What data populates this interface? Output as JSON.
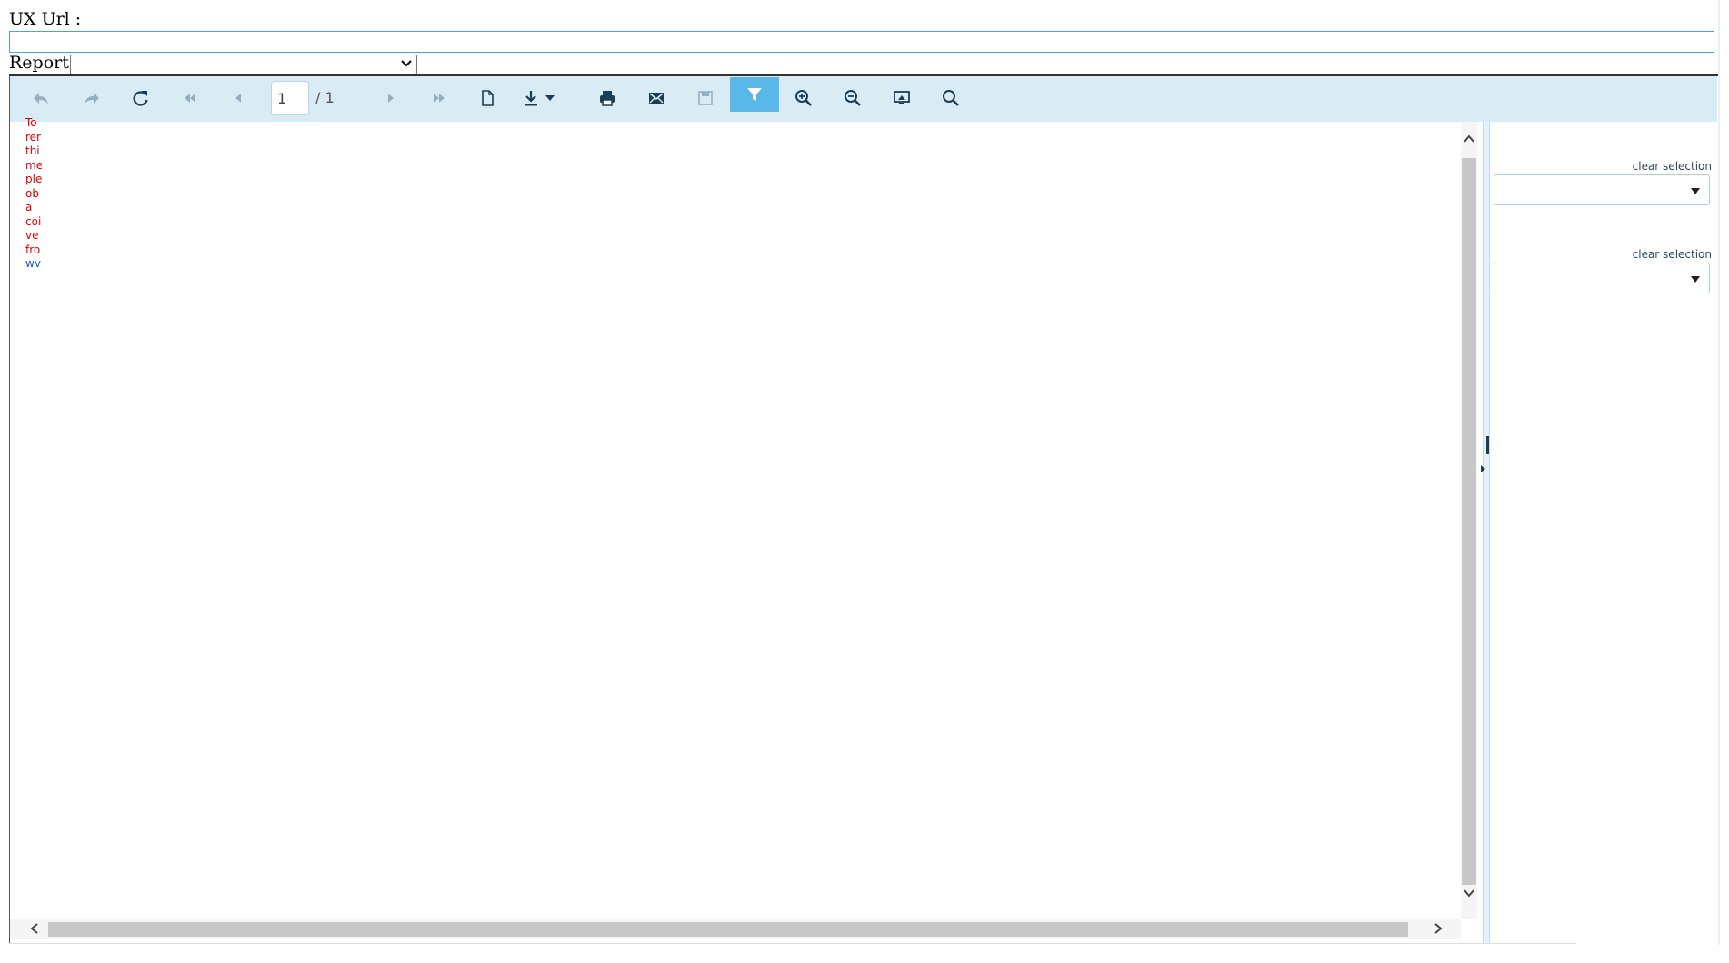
{
  "form": {
    "ux_url_label": "UX Url :",
    "ux_url_value": "",
    "report_label": "Report :",
    "report_selected": ""
  },
  "toolbar": {
    "buttons": [
      {
        "name": "back-icon",
        "enabled": false
      },
      {
        "name": "forward-icon",
        "enabled": false
      },
      {
        "name": "refresh-icon",
        "enabled": true
      },
      {
        "name": "first-page-icon",
        "enabled": false
      },
      {
        "name": "previous-page-icon",
        "enabled": false
      },
      {
        "name": "next-page-icon",
        "enabled": false
      },
      {
        "name": "last-page-icon",
        "enabled": false
      },
      {
        "name": "document-icon",
        "enabled": true
      },
      {
        "name": "download-icon",
        "enabled": true
      },
      {
        "name": "print-icon",
        "enabled": true
      },
      {
        "name": "email-icon",
        "enabled": true
      },
      {
        "name": "save-icon",
        "enabled": false
      },
      {
        "name": "filter-icon",
        "enabled": true,
        "active": true
      },
      {
        "name": "zoom-in-icon",
        "enabled": true
      },
      {
        "name": "zoom-out-icon",
        "enabled": true
      },
      {
        "name": "fit-screen-icon",
        "enabled": true
      },
      {
        "name": "search-icon",
        "enabled": true
      }
    ],
    "page_current": "1",
    "page_total": "/ 1"
  },
  "report_content": {
    "red_lines": [
      "To",
      "rer",
      "thi",
      "me",
      "ple",
      "ob",
      "a",
      "coi",
      "ve",
      "fro"
    ],
    "blue_lines": [
      "wv"
    ]
  },
  "parameters": {
    "clear_label_1": "clear selection",
    "clear_label_2": "clear selection",
    "select_1_value": "",
    "select_2_value": ""
  },
  "colors": {
    "toolbar_bg": "#d9ecf6",
    "active_button": "#5ab8e8",
    "icon": "#1d3c55",
    "error_text": "#e00000",
    "link_text": "#1060c0"
  }
}
